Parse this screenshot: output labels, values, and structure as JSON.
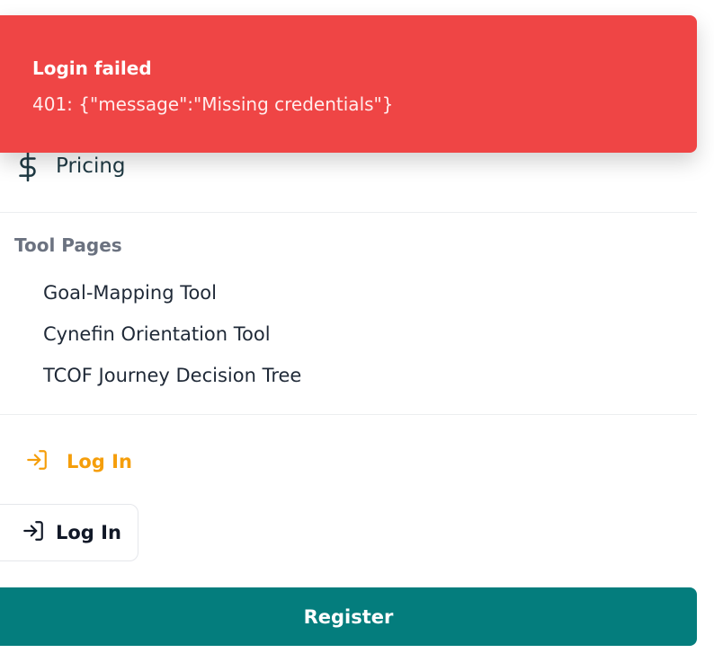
{
  "toast": {
    "title": "Login failed",
    "description": "401: {\"message\":\"Missing credentials\"}",
    "background_color": "#ef4545"
  },
  "nav": {
    "pricing": {
      "label": "Pricing",
      "icon": "dollar-sign-icon"
    }
  },
  "tool_pages": {
    "heading": "Tool Pages",
    "links": [
      {
        "label": "Goal-Mapping Tool"
      },
      {
        "label": "Cynefin Orientation Tool"
      },
      {
        "label": "TCOF Journey Decision Tree"
      }
    ]
  },
  "auth": {
    "login_link": {
      "label": "Log In",
      "icon": "log-in-icon",
      "color": "#f59e0b"
    },
    "login_button": {
      "label": "Log In",
      "icon": "log-in-icon"
    },
    "register_button": {
      "label": "Register",
      "color": "#047d7d"
    }
  }
}
